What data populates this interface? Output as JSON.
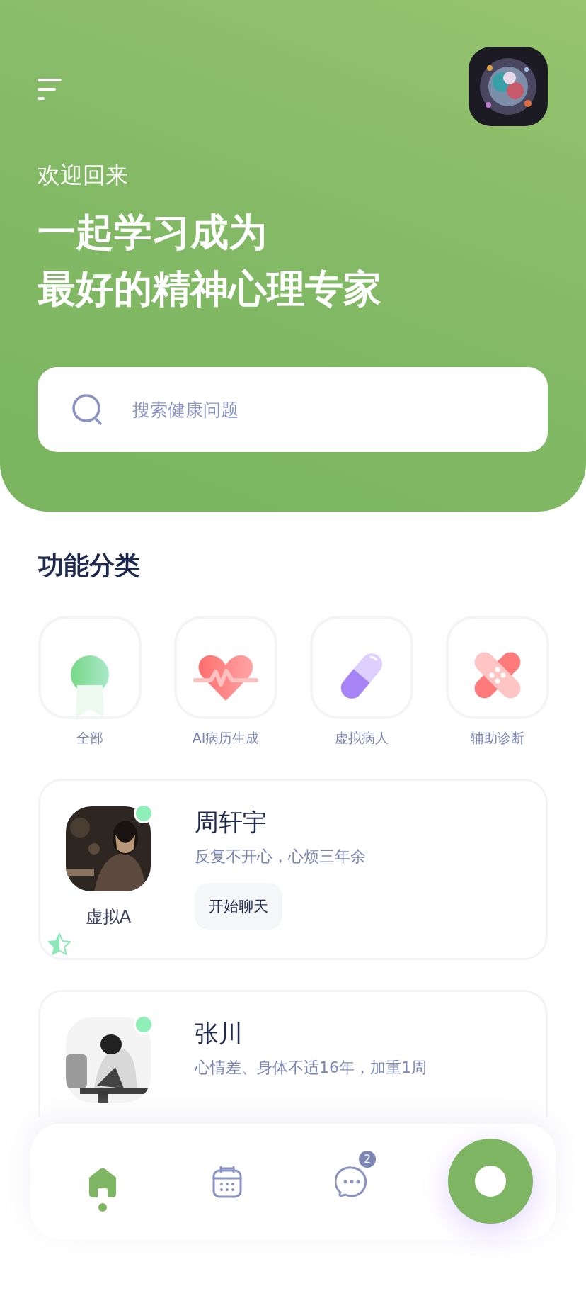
{
  "header": {
    "greeting": "欢迎回来",
    "title_lines": [
      "一起学习成为",
      "最好的精神心理专家"
    ],
    "search": {
      "placeholder": "搜索健康问题"
    }
  },
  "categories_section": {
    "title": "功能分类",
    "items": [
      {
        "label": "全部",
        "kind": "award"
      },
      {
        "label": "AI病历生成",
        "kind": "heart"
      },
      {
        "label": "虚拟病人",
        "kind": "pill"
      },
      {
        "label": "辅助诊断",
        "kind": "bandage"
      }
    ]
  },
  "patients": [
    {
      "name": "周轩宇",
      "complaint": "反复不开心，心烦三年余",
      "avatar_label": "虚拟A",
      "button": "开始聊天",
      "online": true
    },
    {
      "name": "张川",
      "complaint": "心情差、身体不适16年，加重1周",
      "online": true
    }
  ],
  "bottom_nav": {
    "items": [
      {
        "kind": "home",
        "selected": true
      },
      {
        "kind": "calendar",
        "selected": false
      },
      {
        "kind": "chat",
        "selected": false,
        "badge": "2"
      }
    ]
  }
}
